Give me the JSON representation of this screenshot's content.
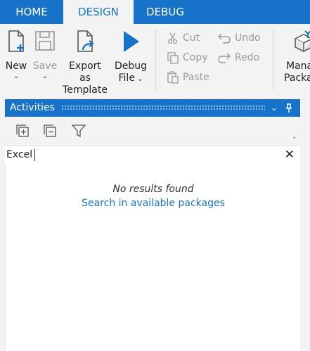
{
  "tabs": [
    {
      "label": "HOME",
      "active": false
    },
    {
      "label": "DESIGN",
      "active": true
    },
    {
      "label": "DEBUG",
      "active": false
    }
  ],
  "ribbon": {
    "new_label": "New",
    "save_label": "Save",
    "export_label_1": "Export as",
    "export_label_2": "Template",
    "debug_label_1": "Debug",
    "debug_label_2": "File",
    "cut_label": "Cut",
    "copy_label": "Copy",
    "paste_label": "Paste",
    "undo_label": "Undo",
    "redo_label": "Redo",
    "manage_label_1": "Mana",
    "manage_label_2": "Packa"
  },
  "panel": {
    "title": "Activities",
    "search_value": "Excel",
    "no_results": "No results found",
    "search_link": "Search in available packages"
  },
  "colors": {
    "accent": "#1673c9",
    "background": "#f3f3f3"
  }
}
